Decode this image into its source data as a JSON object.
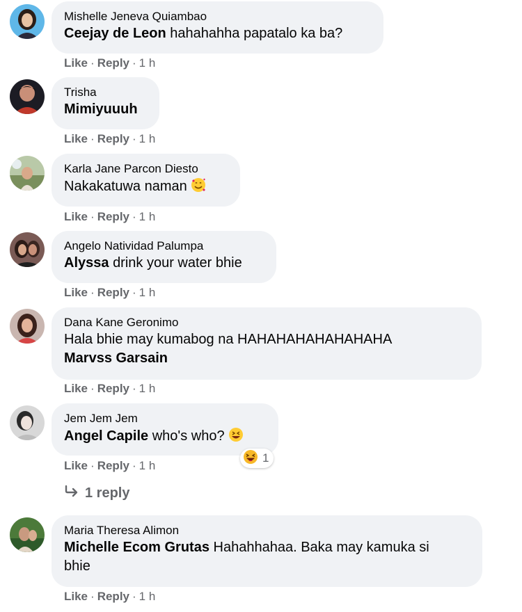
{
  "comments": [
    {
      "author": "Mishelle Jeneva Quiambao",
      "mention": "Ceejay de Leon",
      "text": "hahahahha papatalo ka ba?",
      "avatar": "avatar-woman-blue-icon",
      "like": "Like",
      "reply": "Reply",
      "time": "1 h"
    },
    {
      "author": "Trisha",
      "mention": "Mimiyuuuh",
      "text": "",
      "avatar": "avatar-dark-icon",
      "like": "Like",
      "reply": "Reply",
      "time": "1 h"
    },
    {
      "author": "Karla Jane Parcon Diesto",
      "mention": "",
      "text": "Nakakatuwa naman",
      "emoji": "smiling-face-with-hearts-icon",
      "avatar": "avatar-outdoor-icon",
      "like": "Like",
      "reply": "Reply",
      "time": "1 h"
    },
    {
      "author": "Angelo Natividad Palumpa",
      "mention": "Alyssa",
      "text": "drink your water bhie",
      "avatar": "avatar-couple-icon",
      "like": "Like",
      "reply": "Reply",
      "time": "1 h"
    },
    {
      "author": "Dana Kane Geronimo",
      "mention": "",
      "text": "Hala bhie may kumabog na HAHAHAHAHAHAHAHA",
      "mention_line2": "Marvss Garsain",
      "avatar": "avatar-woman-red-icon",
      "like": "Like",
      "reply": "Reply",
      "time": "1 h"
    },
    {
      "author": "Jem Jem Jem",
      "mention": "Angel Capile",
      "text": "who's who?",
      "emoji": "grinning-squinting-face-icon",
      "avatar": "avatar-grey-icon",
      "reaction": {
        "icon": "haha-reaction-icon",
        "count": "1"
      },
      "like": "Like",
      "reply": "Reply",
      "time": "1 h"
    },
    {
      "author": "Maria Theresa Alimon",
      "mention": "Michelle Ecom Grutas",
      "text": "Hahahhahaa. Baka may kamuka si",
      "text_line2": "bhie",
      "avatar": "avatar-green-icon",
      "like": "Like",
      "reply": "Reply",
      "time": "1 h"
    }
  ],
  "replies_link": {
    "label": "1 reply",
    "icon": "reply-arrow-icon"
  },
  "colors": {
    "bubble": "#f0f2f5",
    "meta": "#65676b",
    "text": "#050505"
  }
}
